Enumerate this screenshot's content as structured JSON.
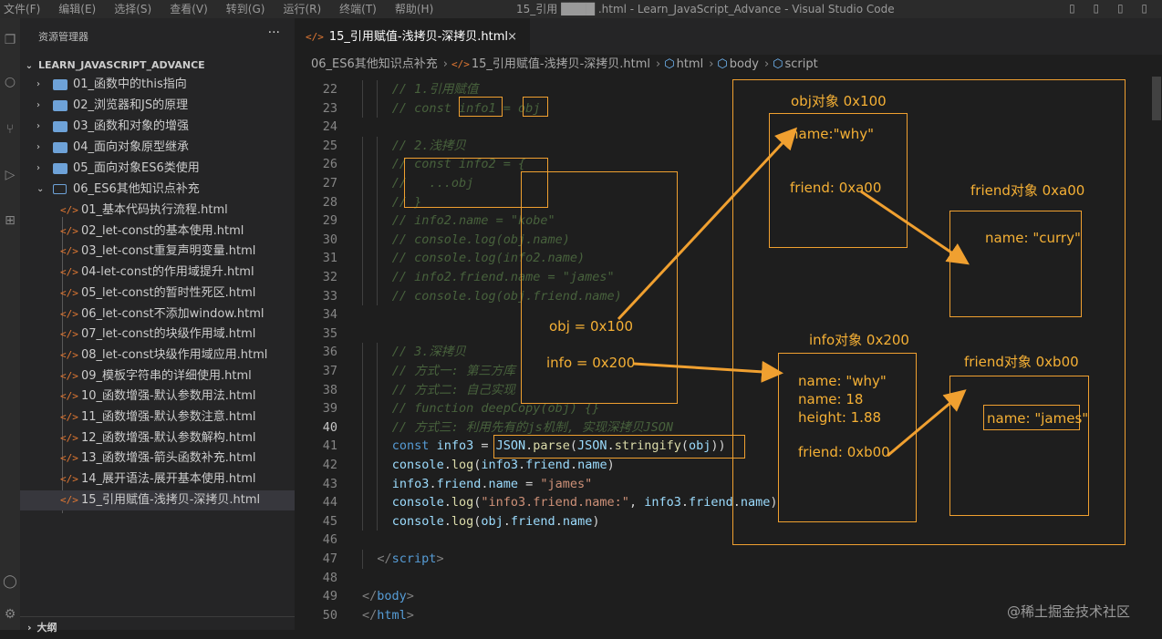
{
  "titlebar": {
    "menu": [
      "文件(F)",
      "编辑(E)",
      "选择(S)",
      "查看(V)",
      "转到(G)",
      "运行(R)",
      "终端(T)",
      "帮助(H)"
    ],
    "window_title": "15_引用 ████ .html - Learn_JavaScript_Advance - Visual Studio Code",
    "controls": "▯ ▯ ▯ ▯"
  },
  "sidebar": {
    "header": "资源管理器",
    "more": "···",
    "root": "LEARN_JAVASCRIPT_ADVANCE",
    "folders": [
      {
        "label": "01_函数中的this指向",
        "expanded": false
      },
      {
        "label": "02_浏览器和JS的原理",
        "expanded": false
      },
      {
        "label": "03_函数和对象的增强",
        "expanded": false
      },
      {
        "label": "04_面向对象原型继承",
        "expanded": false
      },
      {
        "label": "05_面向对象ES6类使用",
        "expanded": false
      },
      {
        "label": "06_ES6其他知识点补充",
        "expanded": true
      }
    ],
    "files": [
      "01_基本代码执行流程.html",
      "02_let-const的基本使用.html",
      "03_let-const重复声明变量.html",
      "04-let-const的作用域提升.html",
      "05_let-const的暂时性死区.html",
      "06_let-const不添加window.html",
      "07_let-const的块级作用域.html",
      "08_let-const块级作用域应用.html",
      "09_模板字符串的详细使用.html",
      "10_函数增强-默认参数用法.html",
      "11_函数增强-默认参数注意.html",
      "12_函数增强-默认参数解构.html",
      "13_函数增强-箭头函数补充.html",
      "14_展开语法-展开基本使用.html",
      "15_引用赋值-浅拷贝-深拷贝.html"
    ],
    "selected_file_index": 14,
    "outline": "大纲"
  },
  "tab": {
    "icon": "</>",
    "label": "15_引用赋值-浅拷贝-深拷贝.html",
    "close": "×"
  },
  "breadcrumb": [
    "06_ES6其他知识点补充",
    "15_引用赋值-浅拷贝-深拷贝.html",
    "html",
    "body",
    "script"
  ],
  "editor": {
    "active_line": 40,
    "lines": [
      {
        "n": "22",
        "ind": 4,
        "parts": [
          {
            "c": "cm",
            "t": "// 1.引用赋值"
          }
        ]
      },
      {
        "n": "23",
        "ind": 4,
        "parts": [
          {
            "c": "cm",
            "t": "// const info1 = obj"
          }
        ]
      },
      {
        "n": "24",
        "ind": 0,
        "parts": []
      },
      {
        "n": "25",
        "ind": 4,
        "parts": [
          {
            "c": "cm",
            "t": "// 2.浅拷贝"
          }
        ]
      },
      {
        "n": "26",
        "ind": 4,
        "parts": [
          {
            "c": "cm",
            "t": "// const info2 = {"
          }
        ]
      },
      {
        "n": "27",
        "ind": 4,
        "parts": [
          {
            "c": "cm",
            "t": "//   ...obj"
          }
        ]
      },
      {
        "n": "28",
        "ind": 4,
        "parts": [
          {
            "c": "cm",
            "t": "// }"
          }
        ]
      },
      {
        "n": "29",
        "ind": 4,
        "parts": [
          {
            "c": "cm",
            "t": "// info2.name = \"kobe\""
          }
        ]
      },
      {
        "n": "30",
        "ind": 4,
        "parts": [
          {
            "c": "cm",
            "t": "// console.log(obj.name)"
          }
        ]
      },
      {
        "n": "31",
        "ind": 4,
        "parts": [
          {
            "c": "cm",
            "t": "// console.log(info2.name)"
          }
        ]
      },
      {
        "n": "32",
        "ind": 4,
        "parts": [
          {
            "c": "cm",
            "t": "// info2.friend.name = \"james\""
          }
        ]
      },
      {
        "n": "33",
        "ind": 4,
        "parts": [
          {
            "c": "cm",
            "t": "// console.log(obj.friend.name)"
          }
        ]
      },
      {
        "n": "34",
        "ind": 0,
        "parts": []
      },
      {
        "n": "35",
        "ind": 0,
        "parts": []
      },
      {
        "n": "36",
        "ind": 4,
        "parts": [
          {
            "c": "cm",
            "t": "// 3.深拷贝"
          }
        ]
      },
      {
        "n": "37",
        "ind": 4,
        "parts": [
          {
            "c": "cm",
            "t": "// 方式一: 第三方库"
          }
        ]
      },
      {
        "n": "38",
        "ind": 4,
        "parts": [
          {
            "c": "cm",
            "t": "// 方式二: 自己实现"
          }
        ]
      },
      {
        "n": "39",
        "ind": 4,
        "parts": [
          {
            "c": "cm",
            "t": "// function deepCopy(obj) {}"
          }
        ]
      },
      {
        "n": "40",
        "ind": 4,
        "parts": [
          {
            "c": "cm",
            "t": "// 方式三: 利用先有的js机制, 实现深拷贝JSON"
          }
        ]
      },
      {
        "n": "41",
        "ind": 4,
        "parts": [
          {
            "c": "kw",
            "t": "const "
          },
          {
            "c": "var",
            "t": "info3"
          },
          {
            "c": "pl",
            "t": " = "
          },
          {
            "c": "var",
            "t": "JSON"
          },
          {
            "c": "pl",
            "t": "."
          },
          {
            "c": "fn",
            "t": "parse"
          },
          {
            "c": "pl",
            "t": "("
          },
          {
            "c": "var",
            "t": "JSON"
          },
          {
            "c": "pl",
            "t": "."
          },
          {
            "c": "fn",
            "t": "stringify"
          },
          {
            "c": "pl",
            "t": "("
          },
          {
            "c": "var",
            "t": "obj"
          },
          {
            "c": "pl",
            "t": "))"
          }
        ]
      },
      {
        "n": "42",
        "ind": 4,
        "parts": [
          {
            "c": "var",
            "t": "console"
          },
          {
            "c": "pl",
            "t": "."
          },
          {
            "c": "fn",
            "t": "log"
          },
          {
            "c": "pl",
            "t": "("
          },
          {
            "c": "var",
            "t": "info3"
          },
          {
            "c": "pl",
            "t": "."
          },
          {
            "c": "var",
            "t": "friend"
          },
          {
            "c": "pl",
            "t": "."
          },
          {
            "c": "var",
            "t": "name"
          },
          {
            "c": "pl",
            "t": ")"
          }
        ]
      },
      {
        "n": "43",
        "ind": 4,
        "parts": [
          {
            "c": "var",
            "t": "info3"
          },
          {
            "c": "pl",
            "t": "."
          },
          {
            "c": "var",
            "t": "friend"
          },
          {
            "c": "pl",
            "t": "."
          },
          {
            "c": "var",
            "t": "name"
          },
          {
            "c": "pl",
            "t": " = "
          },
          {
            "c": "str",
            "t": "\"james\""
          }
        ]
      },
      {
        "n": "44",
        "ind": 4,
        "parts": [
          {
            "c": "var",
            "t": "console"
          },
          {
            "c": "pl",
            "t": "."
          },
          {
            "c": "fn",
            "t": "log"
          },
          {
            "c": "pl",
            "t": "("
          },
          {
            "c": "str",
            "t": "\"info3.friend.name:\""
          },
          {
            "c": "pl",
            "t": ", "
          },
          {
            "c": "var",
            "t": "info3"
          },
          {
            "c": "pl",
            "t": "."
          },
          {
            "c": "var",
            "t": "friend"
          },
          {
            "c": "pl",
            "t": "."
          },
          {
            "c": "var",
            "t": "name"
          },
          {
            "c": "pl",
            "t": ")"
          }
        ]
      },
      {
        "n": "45",
        "ind": 4,
        "parts": [
          {
            "c": "var",
            "t": "console"
          },
          {
            "c": "pl",
            "t": "."
          },
          {
            "c": "fn",
            "t": "log"
          },
          {
            "c": "pl",
            "t": "("
          },
          {
            "c": "var",
            "t": "obj"
          },
          {
            "c": "pl",
            "t": "."
          },
          {
            "c": "var",
            "t": "friend"
          },
          {
            "c": "pl",
            "t": "."
          },
          {
            "c": "var",
            "t": "name"
          },
          {
            "c": "pl",
            "t": ")"
          }
        ]
      },
      {
        "n": "46",
        "ind": 0,
        "parts": []
      },
      {
        "n": "47",
        "ind": 2,
        "parts": [
          {
            "c": "tag",
            "t": "</"
          },
          {
            "c": "tagn",
            "t": "script"
          },
          {
            "c": "tag",
            "t": ">"
          }
        ]
      },
      {
        "n": "48",
        "ind": 0,
        "parts": []
      },
      {
        "n": "49",
        "ind": 0,
        "parts": [
          {
            "c": "tag",
            "t": "</"
          },
          {
            "c": "tagn",
            "t": "body"
          },
          {
            "c": "tag",
            "t": ">"
          }
        ]
      },
      {
        "n": "50",
        "ind": 0,
        "parts": [
          {
            "c": "tag",
            "t": "</"
          },
          {
            "c": "tagn",
            "t": "html"
          },
          {
            "c": "tag",
            "t": ">"
          }
        ]
      }
    ]
  },
  "annotations": {
    "accent_color": "#f0a030",
    "obj_object_title": "obj对象 0x100",
    "obj_name": "name:\"why\"",
    "obj_friend": "friend: 0xa00",
    "friend_a00_title": "friend对象 0xa00",
    "friend_a00_name": "name: \"curry\"",
    "stack_obj": "obj = 0x100",
    "stack_info": "info = 0x200",
    "info_object_title": "info对象 0x200",
    "info_name": "name: \"why\"",
    "info_age": "name: 18",
    "info_height": "height: 1.88",
    "info_friend": "friend: 0xb00",
    "friend_b00_title": "friend对象 0xb00",
    "friend_b00_name": "name: \"james\""
  },
  "watermark": "@稀土掘金技术社区"
}
